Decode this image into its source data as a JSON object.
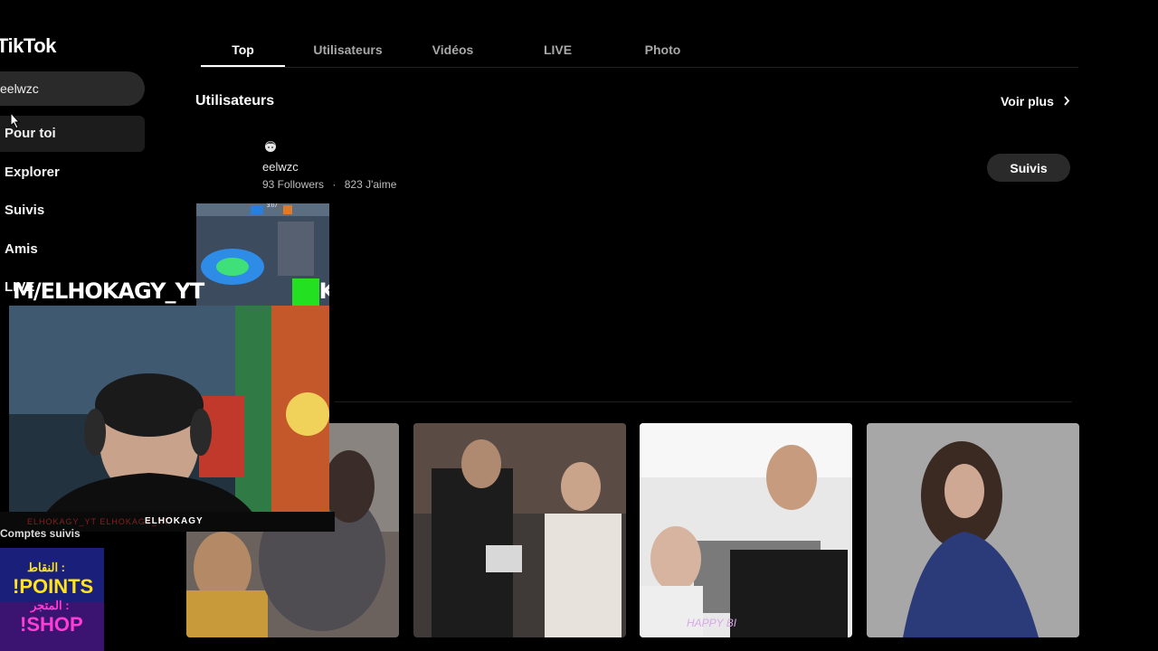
{
  "app": {
    "logo": "TikTok"
  },
  "sidebar": {
    "search_value": "eelwzc",
    "items": [
      {
        "label": "Pour toi"
      },
      {
        "label": "Explorer"
      },
      {
        "label": "Suivis"
      },
      {
        "label": "Amis"
      },
      {
        "label": "LIVE"
      }
    ],
    "following_label": "Comptes suivis"
  },
  "tabs": [
    {
      "label": "Top"
    },
    {
      "label": "Utilisateurs"
    },
    {
      "label": "Vidéos"
    },
    {
      "label": "LIVE"
    },
    {
      "label": "Photo"
    }
  ],
  "users_section": {
    "title": "Utilisateurs",
    "see_more": "Voir plus",
    "user": {
      "name": "eelwzc",
      "followers": "93 Followers",
      "separator": "·",
      "likes": "823 J'aime",
      "follow_label": "Suivis"
    }
  },
  "overlay": {
    "banner_text": "M/ELHOKAGY_YT",
    "banner_tail": "KI",
    "game_timer": "3:07",
    "logo_text": "ELHOKAGY",
    "footer_text": "ELHOKAGY_YT   ELHOKAGY_YT",
    "promo": {
      "line1": "النقاط :",
      "line2": "!POINTS",
      "line3": "المتجر :",
      "line4": "!SHOP"
    }
  },
  "video_thumbs": [
    {
      "caption": ""
    },
    {
      "caption": ""
    },
    {
      "caption": "HAPPY BI"
    },
    {
      "caption": ""
    }
  ],
  "colors": {
    "accent_green": "#23e020",
    "promo_yellow": "#ffe41a",
    "promo_pink": "#ff3dd6"
  }
}
